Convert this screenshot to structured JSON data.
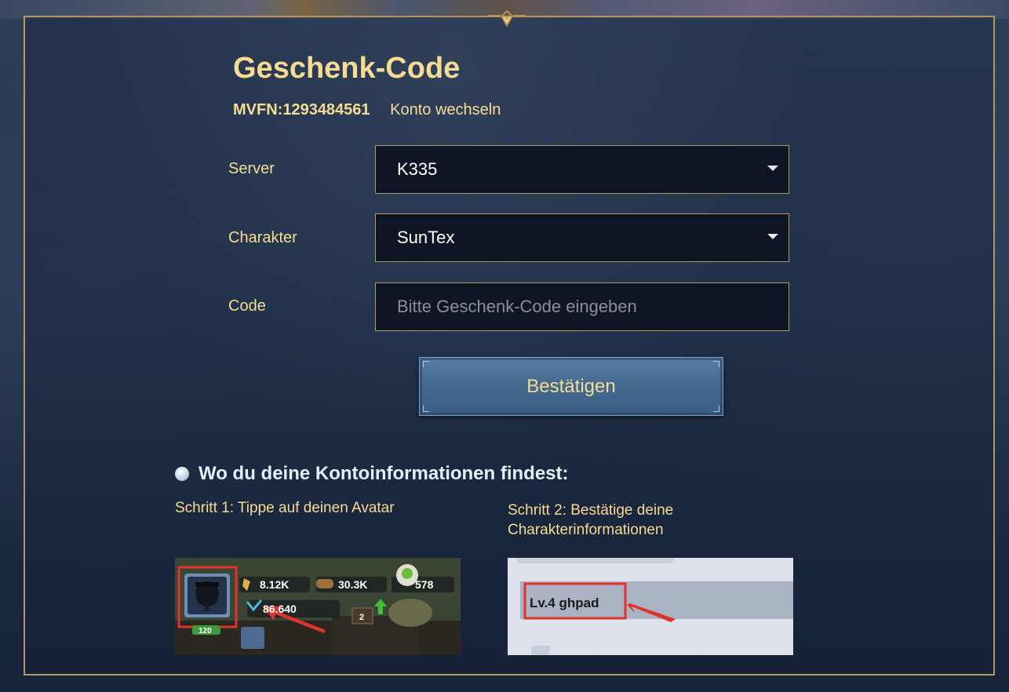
{
  "page": {
    "title": "Geschenk-Code",
    "account_id": "MVFN:1293484561",
    "switch_account": "Konto wechseln"
  },
  "form": {
    "server": {
      "label": "Server",
      "value": "K335"
    },
    "character": {
      "label": "Charakter",
      "value": "SunTex"
    },
    "code": {
      "label": "Code",
      "value": "",
      "placeholder": "Bitte Geschenk-Code eingeben"
    },
    "submit_label": "Bestätigen"
  },
  "help": {
    "heading": "Wo du deine Kontoinformationen findest:",
    "step1": "Schritt 1: Tippe auf deinen Avatar",
    "step2_line1": "Schritt 2: Bestätige deine",
    "step2_line2": "Charakterinformationen",
    "screenshot1": {
      "food": "8.12K",
      "wood": "30.3K",
      "gems": "578",
      "power": "86.640",
      "level": "120",
      "badge": "2"
    },
    "screenshot2": {
      "character_label": "Lv.4 ghpad"
    }
  },
  "colors": {
    "accent_gold": "#f6dc93",
    "frame_border": "#b49660",
    "button_blue": "#44698f",
    "highlight_red": "#e0332a"
  }
}
